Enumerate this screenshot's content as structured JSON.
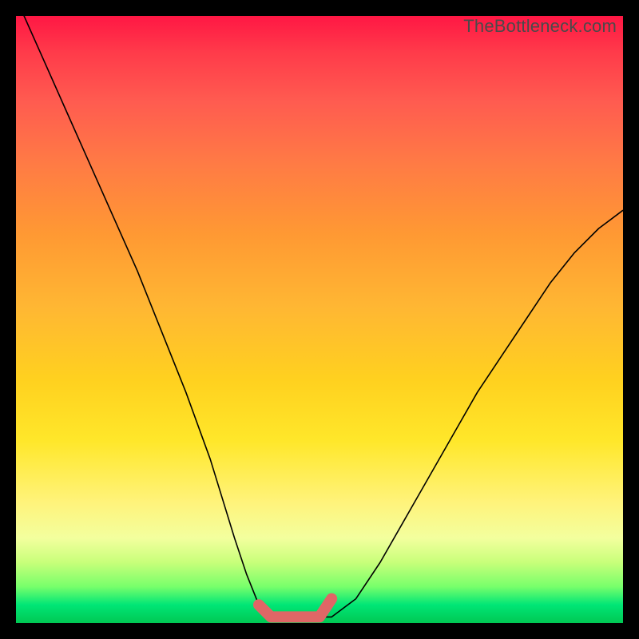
{
  "watermark": "TheBottleneck.com",
  "chart_data": {
    "type": "line",
    "title": "",
    "xlabel": "",
    "ylabel": "",
    "xlim": [
      0,
      100
    ],
    "ylim": [
      0,
      100
    ],
    "grid": false,
    "series": [
      {
        "name": "curve",
        "x": [
          0,
          4,
          8,
          12,
          16,
          20,
          24,
          28,
          32,
          36,
          38,
          40,
          42,
          44,
          48,
          50,
          52,
          56,
          60,
          64,
          68,
          72,
          76,
          80,
          84,
          88,
          92,
          96,
          100
        ],
        "values": [
          103,
          94,
          85,
          76,
          67,
          58,
          48,
          38,
          27,
          14,
          8,
          3,
          1,
          1,
          1,
          1,
          1,
          4,
          10,
          17,
          24,
          31,
          38,
          44,
          50,
          56,
          61,
          65,
          68
        ]
      }
    ],
    "highlight": {
      "name": "optimal-zone",
      "x": [
        40,
        42,
        44,
        48,
        50,
        52
      ],
      "values": [
        3,
        1,
        1,
        1,
        1,
        4
      ],
      "color": "#e06666"
    }
  }
}
